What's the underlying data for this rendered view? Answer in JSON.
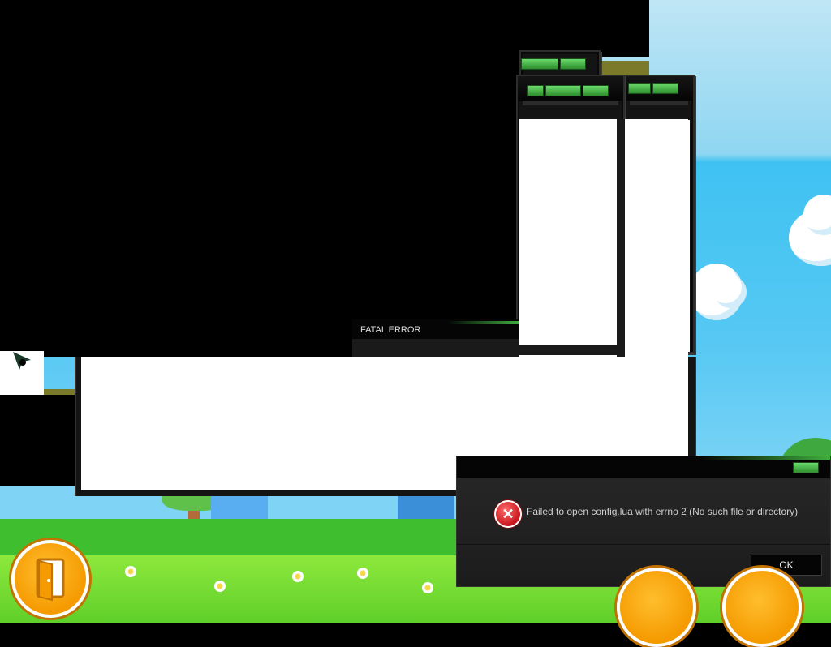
{
  "error_dialog": {
    "title": "",
    "message": "Failed to open config.lua with errno 2 (No such file or directory)",
    "ok_label": "OK",
    "icon": "error-icon",
    "icon_glyph": "✕"
  },
  "fatal_window": {
    "title": "FATAL ERROR"
  },
  "game": {
    "exit_button_icon": "door-exit-icon"
  },
  "colors": {
    "accent_green": "#3fae3f",
    "error_red": "#c8161d",
    "game_orange": "#f59a00"
  }
}
